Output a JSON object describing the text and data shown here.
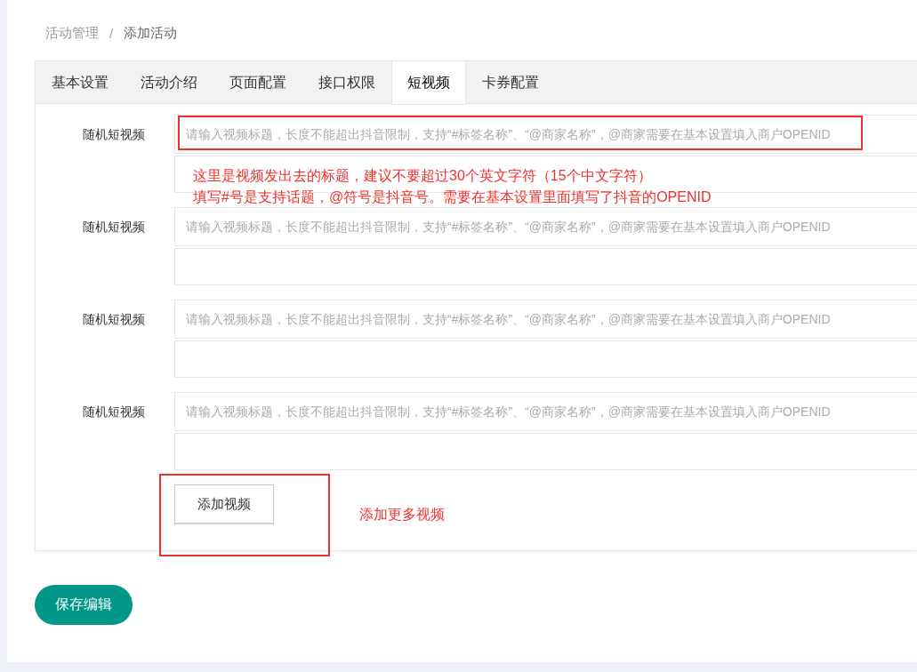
{
  "breadcrumb": {
    "items": [
      {
        "label": "活动管理"
      },
      {
        "label": "添加活动"
      }
    ],
    "separator": "/"
  },
  "tabs": [
    {
      "label": "基本设置",
      "selected": false
    },
    {
      "label": "活动介绍",
      "selected": false
    },
    {
      "label": "页面配置",
      "selected": false
    },
    {
      "label": "接口权限",
      "selected": false
    },
    {
      "label": "短视频",
      "selected": true
    },
    {
      "label": "卡券配置",
      "selected": false
    }
  ],
  "video_fields": [
    {
      "label": "随机短视频",
      "placeholder": "请输入视频标题，长度不能超出抖音限制，支持“#标签名称”、“@商家名称”，@商家需要在基本设置填入商户OPENID"
    },
    {
      "label": "随机短视频",
      "placeholder": "请输入视频标题，长度不能超出抖音限制，支持“#标签名称”、“@商家名称”，@商家需要在基本设置填入商户OPENID"
    },
    {
      "label": "随机短视频",
      "placeholder": "请输入视频标题，长度不能超出抖音限制，支持“#标签名称”、“@商家名称”，@商家需要在基本设置填入商户OPENID"
    },
    {
      "label": "随机短视频",
      "placeholder": "请输入视频标题，长度不能超出抖音限制，支持“#标签名称”、“@商家名称”，@商家需要在基本设置填入商户OPENID"
    }
  ],
  "add_button": "添加视频",
  "save_button": "保存编辑",
  "annotations": {
    "title_note": [
      "这里是视频发出去的标题，建议不要超过30个英文字符（15个中文字符）",
      "填写#号是支持话题，@符号是抖音号。需要在基本设置里面填写了抖音的OPENID"
    ],
    "add_note": "添加更多视频"
  }
}
